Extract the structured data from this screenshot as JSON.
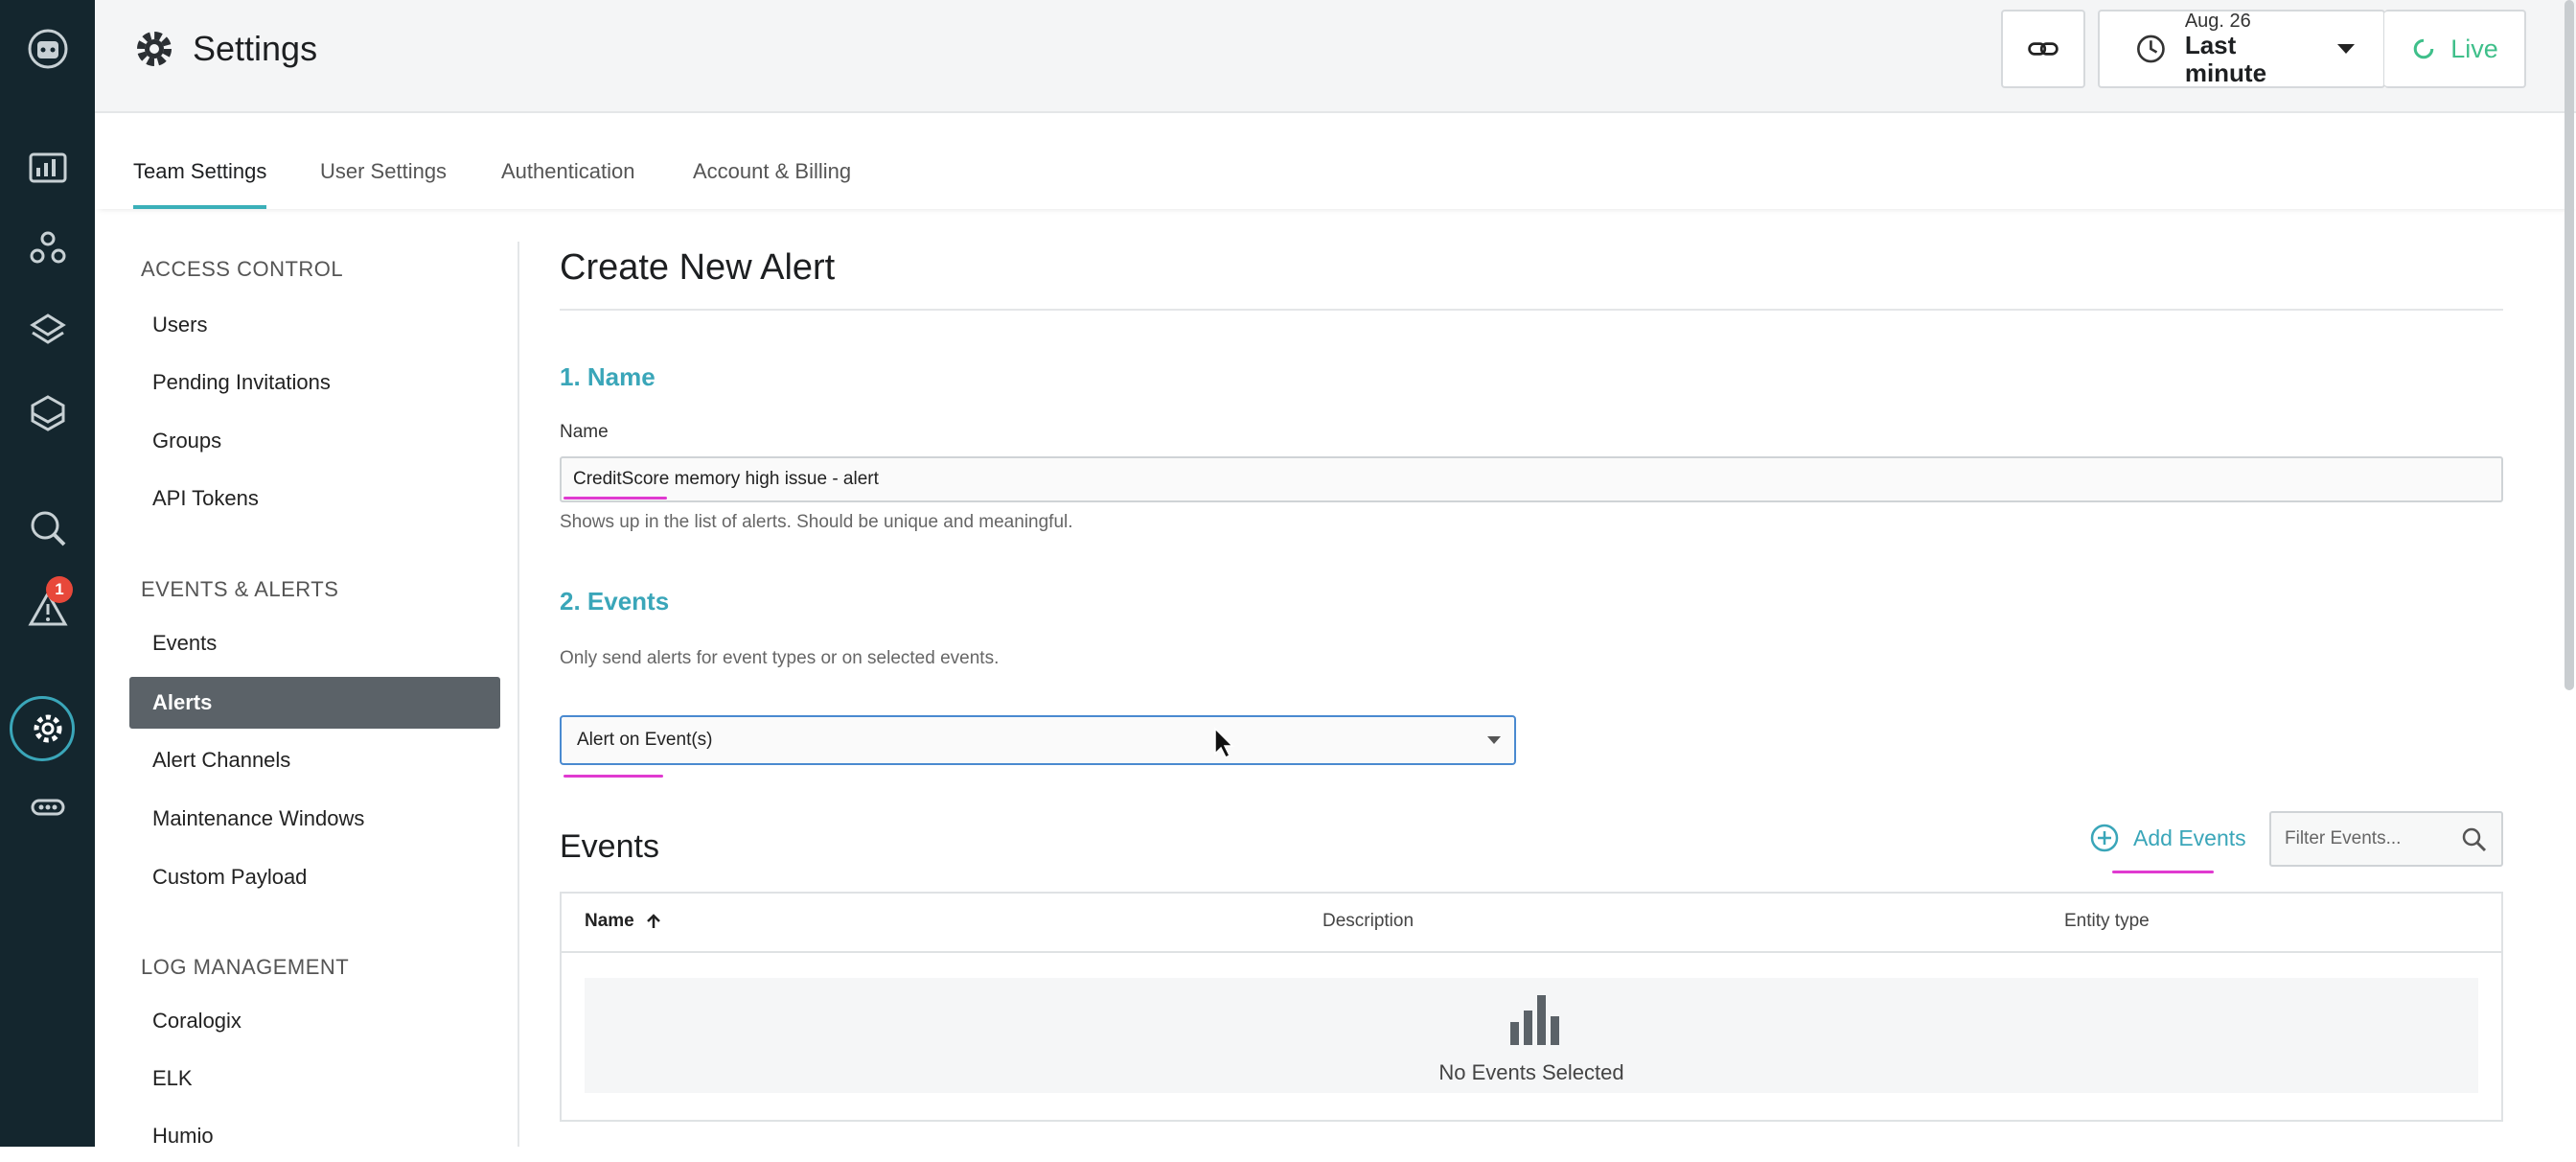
{
  "header": {
    "title": "Settings",
    "time_date": "Aug. 26",
    "time_range": "Last minute",
    "live_label": "Live"
  },
  "tabs": [
    {
      "label": "Team Settings",
      "active": true
    },
    {
      "label": "User Settings"
    },
    {
      "label": "Authentication"
    },
    {
      "label": "Account & Billing"
    }
  ],
  "rail": {
    "alerts_badge": "1"
  },
  "nav": {
    "access_control": {
      "title": "ACCESS CONTROL",
      "items": [
        "Users",
        "Pending Invitations",
        "Groups",
        "API Tokens"
      ]
    },
    "events_alerts": {
      "title": "EVENTS & ALERTS",
      "items": [
        "Events",
        "Alerts",
        "Alert Channels",
        "Maintenance Windows",
        "Custom Payload"
      ],
      "active": "Alerts"
    },
    "log_management": {
      "title": "LOG MANAGEMENT",
      "items": [
        "Coralogix",
        "ELK",
        "Humio"
      ]
    }
  },
  "main": {
    "title": "Create New Alert",
    "step1": "1. Name",
    "name_label": "Name",
    "name_value": "CreditScore memory high issue - alert",
    "name_hint": "Shows up in the list of alerts. Should be unique and meaningful.",
    "step2": "2. Events",
    "events_hint": "Only send alerts for event types or on selected events.",
    "select_value": "Alert on Event(s)",
    "events_title": "Events",
    "add_events": "Add Events",
    "filter_placeholder": "Filter Events...",
    "table": {
      "col_name": "Name",
      "col_description": "Description",
      "col_entity": "Entity type",
      "empty": "No Events Selected"
    }
  },
  "colors": {
    "rail": "#14262e",
    "accent": "#3aa6b9",
    "annotation": "#e03ad0",
    "live": "#3fbf8a",
    "badge": "#e8483a"
  }
}
